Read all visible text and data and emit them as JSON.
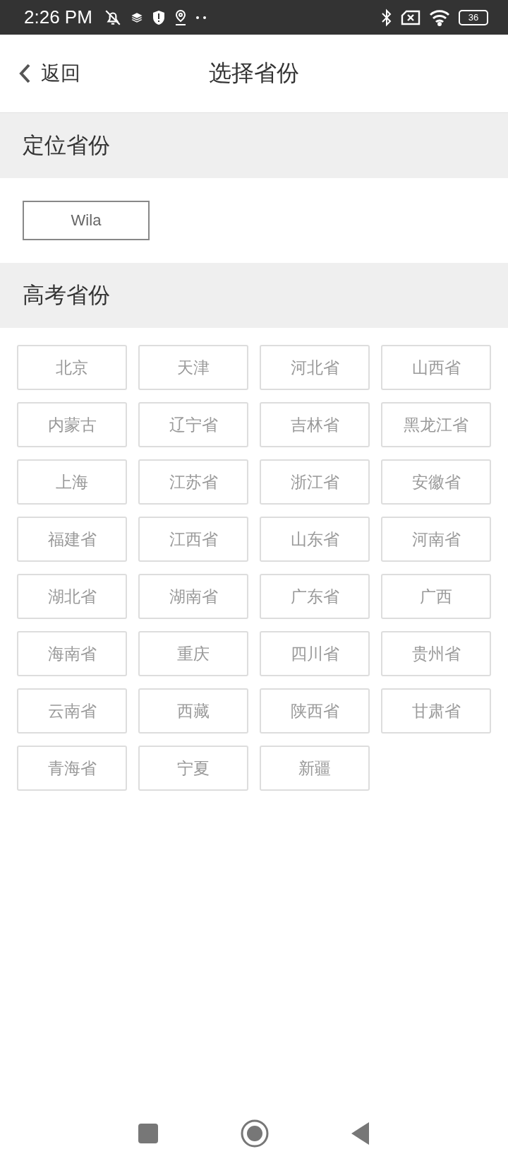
{
  "status_bar": {
    "time": "2:26 PM",
    "battery": "36"
  },
  "header": {
    "back": "返回",
    "title": "选择省份"
  },
  "located_section": {
    "title": "定位省份",
    "province": "Wila"
  },
  "exam_section": {
    "title": "高考省份",
    "provinces": [
      "北京",
      "天津",
      "河北省",
      "山西省",
      "内蒙古",
      "辽宁省",
      "吉林省",
      "黑龙江省",
      "上海",
      "江苏省",
      "浙江省",
      "安徽省",
      "福建省",
      "江西省",
      "山东省",
      "河南省",
      "湖北省",
      "湖南省",
      "广东省",
      "广西",
      "海南省",
      "重庆",
      "四川省",
      "贵州省",
      "云南省",
      "西藏",
      "陕西省",
      "甘肃省",
      "青海省",
      "宁夏",
      "新疆"
    ]
  }
}
